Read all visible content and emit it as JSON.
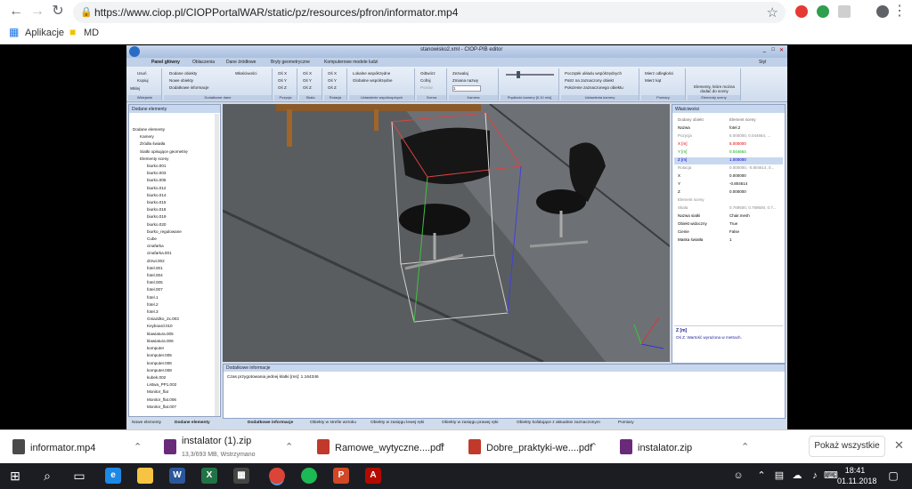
{
  "browser": {
    "url": "https://www.ciop.pl/CIOPPortalWAR/static/pz/resources/pfron/informator.mp4",
    "bookmarks": [
      {
        "label": "Aplikacje"
      },
      {
        "label": "MD"
      }
    ]
  },
  "app": {
    "window_title": "stanowisko2.xml - CIOP-PIB editor",
    "style_label": "Styl",
    "ribbon_tabs": [
      "Panel główny",
      "Oblaczenia",
      "Dane źródłowe",
      "Bryły geometryczne",
      "Komputerowe modele ludzi"
    ],
    "ribbon_groups": [
      {
        "label": "Wklejanie",
        "items": [
          "Usuń",
          "Kopiuj",
          "Wklej"
        ]
      },
      {
        "label": "Dodatkowe dane",
        "items": [
          "Dodane obiekty",
          "Nowe obiekty",
          "Dodatkowe informacje",
          "Właściwości"
        ]
      },
      {
        "label": "Pozycja",
        "items": [
          "Oś X",
          "Oś Y",
          "Oś Z"
        ]
      },
      {
        "label": "Skala",
        "items": [
          "Oś X",
          "Oś Y",
          "Oś Z"
        ]
      },
      {
        "label": "Rotacja",
        "items": [
          "Oś X",
          "Oś Y",
          "Oś Z"
        ]
      },
      {
        "label": "Ustawienie współrzędnych",
        "items": [
          "Lokalne współrzędne",
          "Globalne współrzędne"
        ]
      },
      {
        "label": "Scena",
        "items": [
          "Odtwórz",
          "Cofnij",
          "Ponów"
        ]
      },
      {
        "label": "Kamera",
        "items": [
          "Zezwalaj",
          "Zmiana nazwy",
          "1"
        ]
      },
      {
        "label": "Prędkość kamery [0.10 m/s]",
        "items": []
      },
      {
        "label": "Ustawienia kamery",
        "items": [
          "Początek układu współrzędnych",
          "Patrz na zaznaczony obiekt",
          "Położenie zaznaczonego obiektu"
        ]
      },
      {
        "label": "Pomiary",
        "items": [
          "Mierz odległości",
          "Mierz kąt"
        ]
      },
      {
        "label": "Elementy sceny",
        "items": [
          "Elementy, które można dodać do sceny"
        ]
      }
    ],
    "left_panel": {
      "title": "Dodane elementy",
      "items": [
        "Dodane elementy",
        "Kamery",
        "Źródła światła",
        "Siatki opisujące geometrię",
        "Elementy sceny",
        "biurko.001",
        "biurko.003",
        "biurko.005",
        "biurko.012",
        "biurko.014",
        "biurko.015",
        "biurko.018",
        "biurko.019",
        "biurko.020",
        "biurko_regulowane",
        "Cube",
        "cinafarka",
        "cinafarka.001",
        "drzwi.002",
        "fotel.001",
        "fotel.004",
        "fotel.005",
        "fotel.007",
        "fotel.1",
        "fotel.2",
        "fotel.3",
        "Gniazdko_2x.003",
        "Keyboard.010",
        "klawiatura.005",
        "klawiatura.006",
        "komputer",
        "komputer.005",
        "komputer.006",
        "komputer.008",
        "kubek.002",
        "Listwa_PP1.002",
        "Monitor_flat",
        "Monitor_flat.006",
        "Monitor_flat.007"
      ],
      "tabs": [
        "Nowe elementy",
        "Dodane elementy"
      ]
    },
    "properties": {
      "title": "Właściwości",
      "header_key": "Dodany obiekt",
      "header_value": "Element sceny",
      "rows": [
        {
          "key": "Nazwa",
          "value": "fotel.2",
          "color": "#000"
        },
        {
          "key": "Pozycja",
          "value": "5.000000, 0.044664, ...",
          "color": "#888"
        },
        {
          "key": "X [m]",
          "value": "5.000000",
          "color": "#d00"
        },
        {
          "key": "Y [m]",
          "value": "0.044664",
          "color": "#1a1"
        },
        {
          "key": "Z [m]",
          "value": "1.000000",
          "color": "#00c"
        },
        {
          "key": "Rotacja",
          "value": "0.000000, -0.804614, 0...",
          "color": "#888"
        },
        {
          "key": "X",
          "value": "0.000000",
          "color": "#000"
        },
        {
          "key": "Y",
          "value": "-0.804614",
          "color": "#000"
        },
        {
          "key": "Z",
          "value": "0.000000",
          "color": "#000"
        },
        {
          "key": "Element sceny",
          "value": "",
          "color": "#888"
        },
        {
          "key": "Skala",
          "value": "0.769500, 0.769500, 0.7...",
          "color": "#888"
        },
        {
          "key": "Nazwa siatki",
          "value": "Chair.mesh",
          "color": "#000"
        },
        {
          "key": "Obiekt widoczny",
          "value": "True",
          "color": "#000"
        },
        {
          "key": "Cienie",
          "value": "False",
          "color": "#000"
        },
        {
          "key": "Maska światła",
          "value": "1",
          "color": "#000"
        }
      ],
      "help_title": "Z [m]",
      "help_text": "Oś Z. Wartość wyrażona w metrach."
    },
    "info_panel": {
      "title": "Dodatkowe informacje",
      "line": "Czas przygotowania jednej klatki [ms]:   1.164346"
    },
    "bottom_tabs": [
      "Dodatkowe informacje",
      "Obiekty w strefie wzroku",
      "Obiekty w zasięgu lewej ręki",
      "Obiekty w zasięgu prawej ręki",
      "Obiekty kolidujące z aktualnie zaznaczonym",
      "Pomiary"
    ]
  },
  "downloads": [
    {
      "name": "informator.mp4",
      "sub": "",
      "icon_color": "#4a4a4a"
    },
    {
      "name": "instalator (1).zip",
      "sub": "13,3/693 MB, Wstrzymano",
      "icon_color": "#6a2a7a"
    },
    {
      "name": "Ramowe_wytyczne....pdf",
      "sub": "",
      "icon_color": "#c0392b"
    },
    {
      "name": "Dobre_praktyki-we....pdf",
      "sub": "",
      "icon_color": "#c0392b"
    },
    {
      "name": "instalator.zip",
      "sub": "",
      "icon_color": "#6a2a7a"
    }
  ],
  "show_all_label": "Pokaż wszystkie",
  "taskbar": {
    "time": "18:41",
    "date": "01.11.2018"
  }
}
